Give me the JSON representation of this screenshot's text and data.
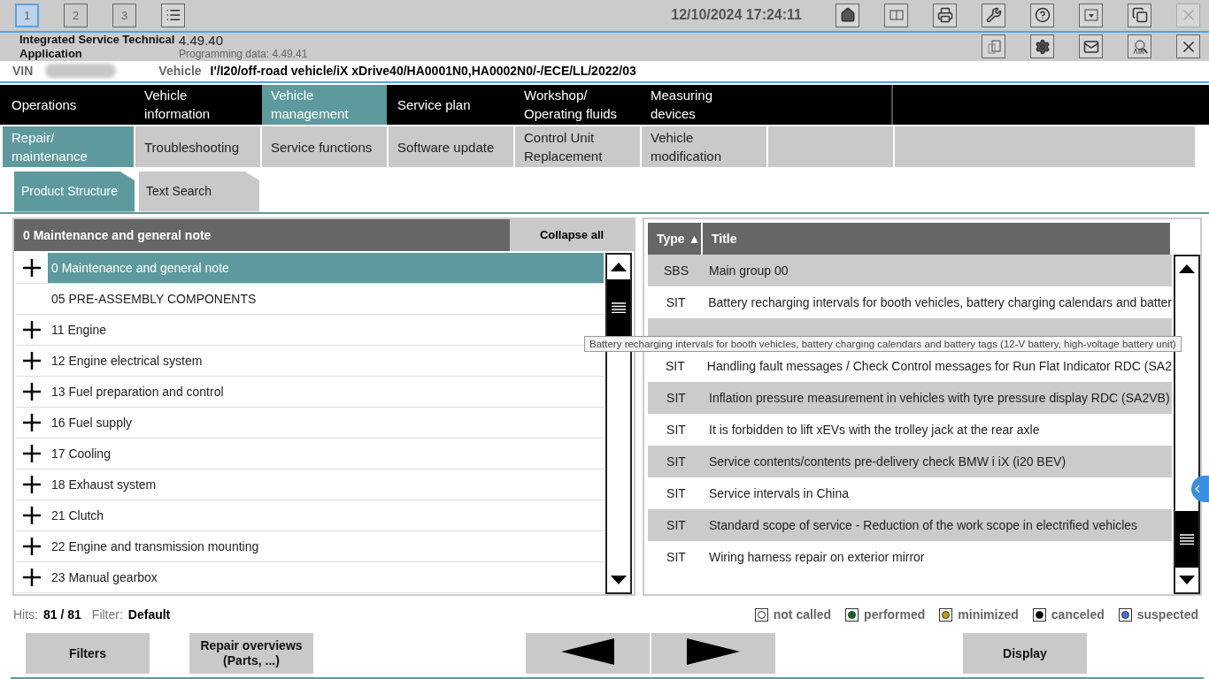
{
  "top_bar": {
    "workspaces": [
      {
        "label": "1",
        "selected": true
      },
      {
        "label": "2",
        "selected": false
      },
      {
        "label": "3",
        "selected": false
      }
    ],
    "datetime": "12/10/2024 17:24:11",
    "close_disabled": true
  },
  "app": {
    "name": "Integrated Service Technical Application",
    "version": "4.49.40",
    "programming_label": "Programming data:",
    "programming_version": "4.49.41"
  },
  "vehicle_bar": {
    "vin_label": "VIN",
    "vehicle_label": "Vehicle",
    "vehicle": "I'/I20/off-road vehicle/iX xDrive40/HA0001N0,HA0002N0/-/ECE/LL/2022/03"
  },
  "main_tabs": [
    {
      "label": "Operations",
      "selected": false
    },
    {
      "label": "Vehicle information",
      "selected": false
    },
    {
      "label": "Vehicle management",
      "selected": true
    },
    {
      "label": "Service plan",
      "selected": false
    },
    {
      "label": "Workshop/ Operating fluids",
      "selected": false
    },
    {
      "label": "Measuring devices",
      "selected": false
    }
  ],
  "sub_tabs": [
    {
      "label": "Repair/ maintenance",
      "selected": true
    },
    {
      "label": "Troubleshooting",
      "selected": false
    },
    {
      "label": "Service functions",
      "selected": false
    },
    {
      "label": "Software update",
      "selected": false
    },
    {
      "label": "Control Unit Replacement",
      "selected": false
    },
    {
      "label": "Vehicle modification",
      "selected": false
    }
  ],
  "view_tabs": [
    {
      "label": "Product Structure",
      "selected": true
    },
    {
      "label": "Text Search",
      "selected": false
    }
  ],
  "tree": {
    "title": "0 Maintenance and general note",
    "collapse_button": "Collapse all",
    "items": [
      {
        "label": "0 Maintenance and general note",
        "expandable": true,
        "selected": true
      },
      {
        "label": "05 PRE-ASSEMBLY COMPONENTS",
        "expandable": false,
        "selected": false
      },
      {
        "label": "11 Engine",
        "expandable": true,
        "selected": false
      },
      {
        "label": "12 Engine electrical system",
        "expandable": true,
        "selected": false
      },
      {
        "label": "13 Fuel preparation and control",
        "expandable": true,
        "selected": false
      },
      {
        "label": "16 Fuel supply",
        "expandable": true,
        "selected": false
      },
      {
        "label": "17 Cooling",
        "expandable": true,
        "selected": false
      },
      {
        "label": "18 Exhaust system",
        "expandable": true,
        "selected": false
      },
      {
        "label": "21 Clutch",
        "expandable": true,
        "selected": false
      },
      {
        "label": "22 Engine and transmission mounting",
        "expandable": true,
        "selected": false
      },
      {
        "label": "23 Manual gearbox",
        "expandable": true,
        "selected": false
      }
    ]
  },
  "documents": {
    "columns": [
      "Type ▲",
      "Title"
    ],
    "rows": [
      {
        "type": "SBS",
        "title": "Main group 00"
      },
      {
        "type": "SIT",
        "title": "Battery recharging intervals for booth vehicles, battery charging calendars and batter"
      },
      {
        "covered": true
      },
      {
        "type": "SIT",
        "title": "Handling fault messages / Check Control messages for Run Flat Indicator RDC (SA2"
      },
      {
        "type": "SIT",
        "title": "Inflation pressure measurement in vehicles with tyre pressure display RDC (SA2VB)"
      },
      {
        "type": "SIT",
        "title": "It is forbidden to lift xEVs with the trolley jack at the rear axle"
      },
      {
        "type": "SIT",
        "title": "Service contents/contents pre-delivery check BMW i iX (i20 BEV)"
      },
      {
        "type": "SIT",
        "title": "Service intervals in China"
      },
      {
        "type": "SIT",
        "title": "Standard scope of service - Reduction of the work scope in electrified vehicles"
      },
      {
        "type": "SIT",
        "title": "Wiring harness repair on exterior mirror"
      }
    ],
    "tooltip": "Battery recharging intervals for booth vehicles, battery charging calendars and battery tags (12-V battery, high-voltage battery unit)"
  },
  "status": {
    "hits_label": "Hits:",
    "hits": "81 / 81",
    "filter_label": "Filter:",
    "filter": "Default"
  },
  "legend": [
    {
      "label": "not called",
      "color": "#ffffff"
    },
    {
      "label": "performed",
      "color": "#0b6b1a"
    },
    {
      "label": "minimized",
      "color": "#c49a1a"
    },
    {
      "label": "canceled",
      "color": "#000000"
    },
    {
      "label": "suspected",
      "color": "#4a6fd8"
    }
  ],
  "buttons": {
    "filters": "Filters",
    "repair_overviews": "Repair overviews (Parts, ...)",
    "display": "Display"
  }
}
